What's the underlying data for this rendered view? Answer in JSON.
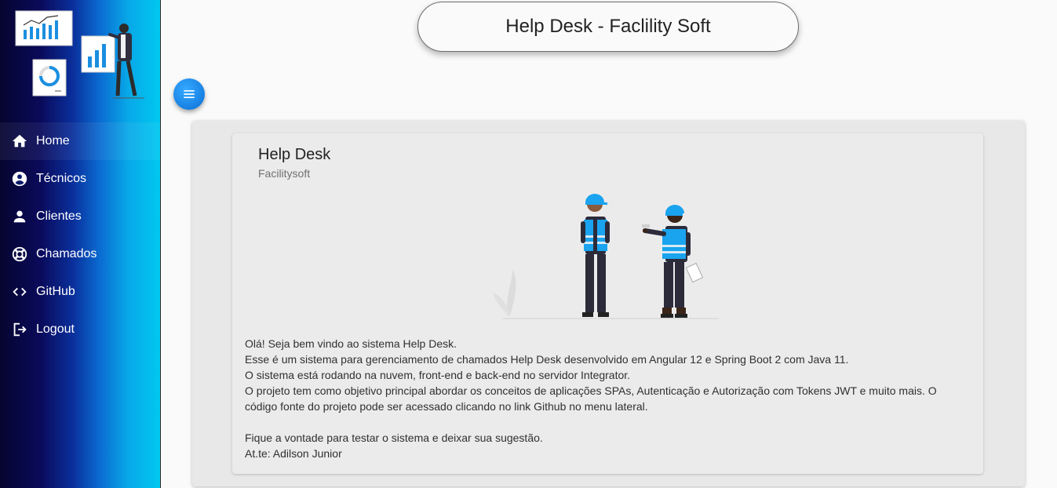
{
  "header": {
    "title": "Help Desk - Faclility Soft"
  },
  "sidebar": {
    "items": [
      {
        "label": "Home",
        "icon": "home-icon"
      },
      {
        "label": "Técnicos",
        "icon": "account-circle-icon"
      },
      {
        "label": "Clientes",
        "icon": "person-icon"
      },
      {
        "label": "Chamados",
        "icon": "lifebuoy-icon"
      },
      {
        "label": "GitHub",
        "icon": "code-icon"
      },
      {
        "label": "Logout",
        "icon": "logout-icon"
      }
    ]
  },
  "card": {
    "title": "Help Desk",
    "subtitle": "Facilitysoft",
    "lines": [
      "Olá! Seja bem vindo ao sistema Help Desk.",
      "Esse é um sistema para gerenciamento de chamados Help Desk desenvolvido em Angular 12 e Spring Boot 2 com Java 11.",
      "O sistema está rodando na nuvem, front-end e back-end no servidor Integrator.",
      "O projeto tem como objetivo principal abordar os conceitos de aplicações SPAs, Autenticação e Autorização com Tokens JWT e muito mais. O código fonte do projeto pode ser acessado clicando no link Github no menu lateral.",
      "",
      "Fique a vontade para testar o sistema e deixar sua sugestão.",
      "At.te: Adilson Junior"
    ]
  },
  "colors": {
    "accent": "#1e88e5",
    "sidebar_end": "#00c8f0",
    "sidebar_start": "#050530"
  }
}
